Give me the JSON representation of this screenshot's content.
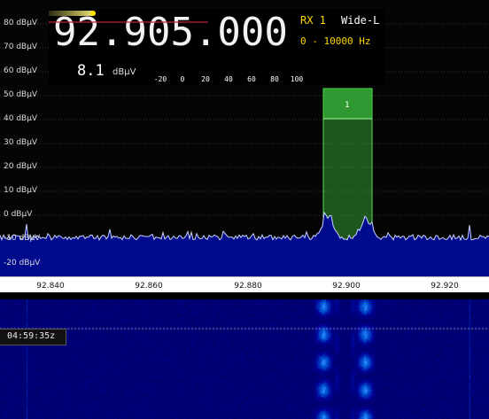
{
  "receiver": {
    "frequency": "92.905.000",
    "rx_label": "RX 1",
    "mode": "Wide-L",
    "audio_bandwidth": "0 - 10000 Hz",
    "signal_level": "8.1",
    "signal_unit": "dBµV",
    "meter_fraction": 0.45,
    "meter_ticks": [
      "-20",
      "0",
      "20",
      "40",
      "60",
      "80",
      "100"
    ]
  },
  "spectrum": {
    "db_labels": [
      "80 dBµV",
      "70 dBµV",
      "60 dBµV",
      "50 dBµV",
      "40 dBµV",
      "30 dBµV",
      "20 dBµV",
      "10 dBµV",
      "0 dBµV",
      "-10 dBµV",
      "-20 dBµV"
    ],
    "freq_ticks": [
      "92.840",
      "92.860",
      "92.880",
      "92.900",
      "92.920"
    ],
    "channel_marker": "1"
  },
  "waterfall": {
    "timestamp": "04:59:35z"
  },
  "colors": {
    "spectrum_fill": "#000a8c",
    "spectrum_line": "#c8d2ff",
    "passband": "#3dbb3d",
    "accent": "#ffd700"
  }
}
